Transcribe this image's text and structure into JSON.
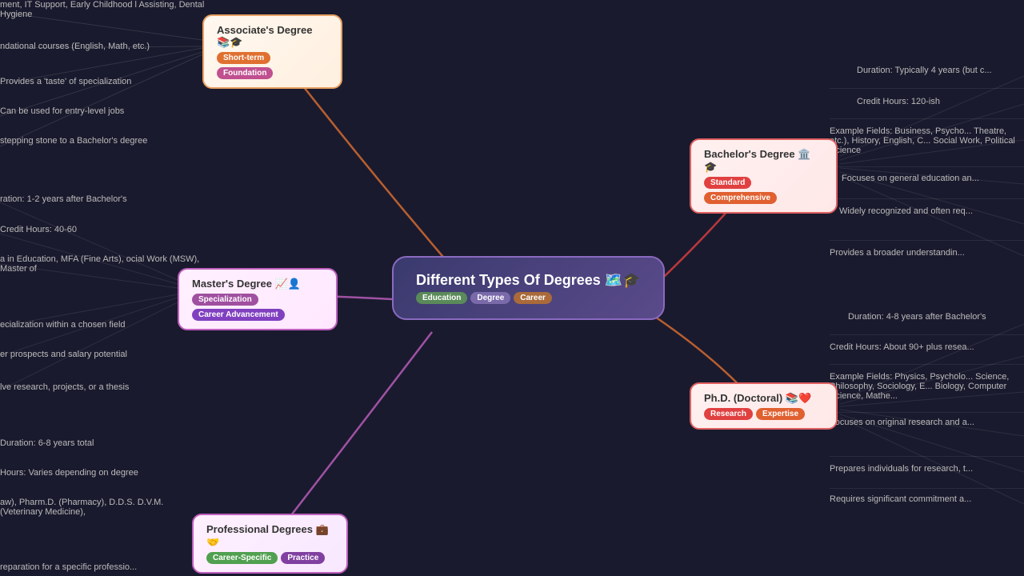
{
  "center": {
    "title": "Different Types Of Degrees 🗺️🎓",
    "tags": [
      "Education",
      "Degree",
      "Career"
    ]
  },
  "assoc": {
    "title": "Associate's Degree 📚🎓",
    "tags": [
      "Short-term",
      "Foundation"
    ]
  },
  "master": {
    "title": "Master's Degree 📈👤",
    "tags": [
      "Specialization",
      "Career Advancement"
    ]
  },
  "prof": {
    "title": "Professional Degrees 💼🤝",
    "tags": [
      "Career-Specific",
      "Practice"
    ]
  },
  "bach": {
    "title": "Bachelor's Degree 🏛️🎓",
    "tags": [
      "Standard",
      "Comprehensive"
    ]
  },
  "phd": {
    "title": "Ph.D. (Doctoral) 📚❤️",
    "tags": [
      "Research",
      "Expertise"
    ]
  },
  "left_info": {
    "mgmt": "ment, IT Support, Early Childhood\nl Assisting, Dental Hygiene",
    "found": "ndational courses (English, Math, etc.)",
    "taste": "Provides a 'taste' of specialization",
    "entry": "Can be used for entry-level jobs",
    "step": "stepping stone to a Bachelor's degree",
    "dur_m": "ration: 1-2 years after Bachelor's",
    "cr_m": "Credit Hours: 40-60",
    "ex_m": "a in Education,  MFA (Fine Arts),\nocial Work (MSW),  Master of",
    "spec_m": "ecialization within a chosen field",
    "salary": "er prospects and salary potential",
    "thesis": "lve research, projects, or a thesis",
    "dur_p": "Duration: 6-8 years total",
    "cr_p": "Hours: Varies depending on degree",
    "ex_p": "aw), Pharm.D. (Pharmacy),  D.D.S.\n D.V.M. (Veterinary Medicine),",
    "prep": "reparation for a specific professio..."
  },
  "right_info": {
    "dur_b": "Duration: Typically 4 years (but c...",
    "cr_b": "Credit Hours: 120-ish",
    "ex_b": "Example Fields: Business, Psycho...\nTheatre, etc.), History, English, C...\nSocial Work, Political Science",
    "gen_b": "Focuses on general education an...",
    "wide_b": "Widely recognized and often req...",
    "broad_b": "Provides a broader understandin...",
    "dur_phd": "Duration: 4-8 years after Bachelor's",
    "cr_phd": "Credit Hours: About 90+ plus resea...",
    "ex_phd": "Example Fields: Physics, Psycholo...\nScience, Philosophy, Sociology, E...\nBiology,  Computer Science,  Mathe...",
    "orig_phd": "Focuses on original research and a...",
    "prep_phd": "Prepares individuals for research, t...",
    "req_phd": "Requires significant commitment a..."
  }
}
